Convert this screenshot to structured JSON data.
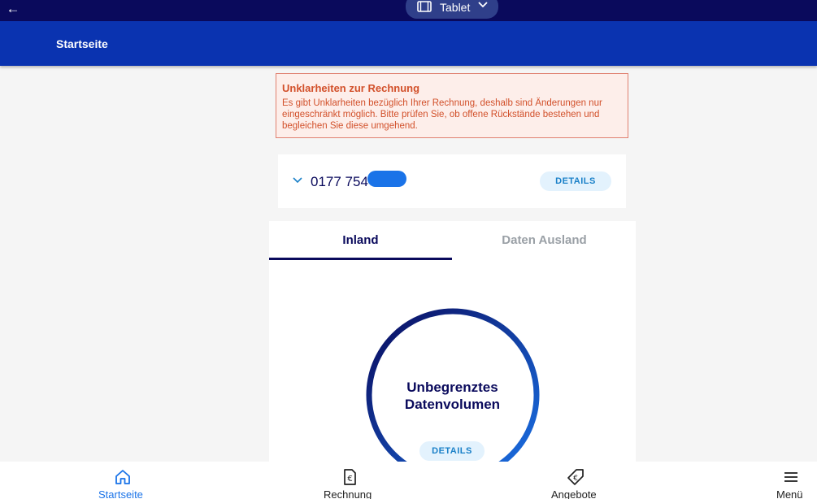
{
  "topbar": {
    "back_icon": "arrow-left-icon",
    "device_label": "Tablet",
    "device_icon": "tablet-icon",
    "chevron_icon": "chevron-down-icon"
  },
  "appbar": {
    "title": "Startseite",
    "color": "#0a33b0"
  },
  "alert": {
    "title": "Unklarheiten zur Rechnung",
    "body": "Es gibt Unklarheiten bezüglich Ihrer Rechnung, deshalb sind Änderungen nur eingeschränkt möglich. Bitte prüfen Sie, ob offene Rückstände bestehen und begleichen Sie diese umgehend.",
    "color": "#d2502a"
  },
  "number_card": {
    "phone": "0177 754",
    "details_label": "DETAILS"
  },
  "tabs": [
    {
      "label": "Inland",
      "active": true
    },
    {
      "label": "Daten Ausland",
      "active": false
    }
  ],
  "gauge": {
    "line1": "Unbegrenztes",
    "line2": "Datenvolumen",
    "details_label": "DETAILS",
    "fill_fraction": 1.0
  },
  "bottom_nav": [
    {
      "label": "Startseite",
      "icon": "home-icon",
      "active": true
    },
    {
      "label": "Rechnung",
      "icon": "invoice-icon",
      "active": false
    },
    {
      "label": "Angebote",
      "icon": "offers-tag-icon",
      "active": false
    },
    {
      "label": "Menü",
      "icon": "menu-icon",
      "active": false
    }
  ],
  "colors": {
    "primary": "#0a0a5c",
    "accent": "#1a80c8",
    "active_nav": "#1a73e8"
  }
}
